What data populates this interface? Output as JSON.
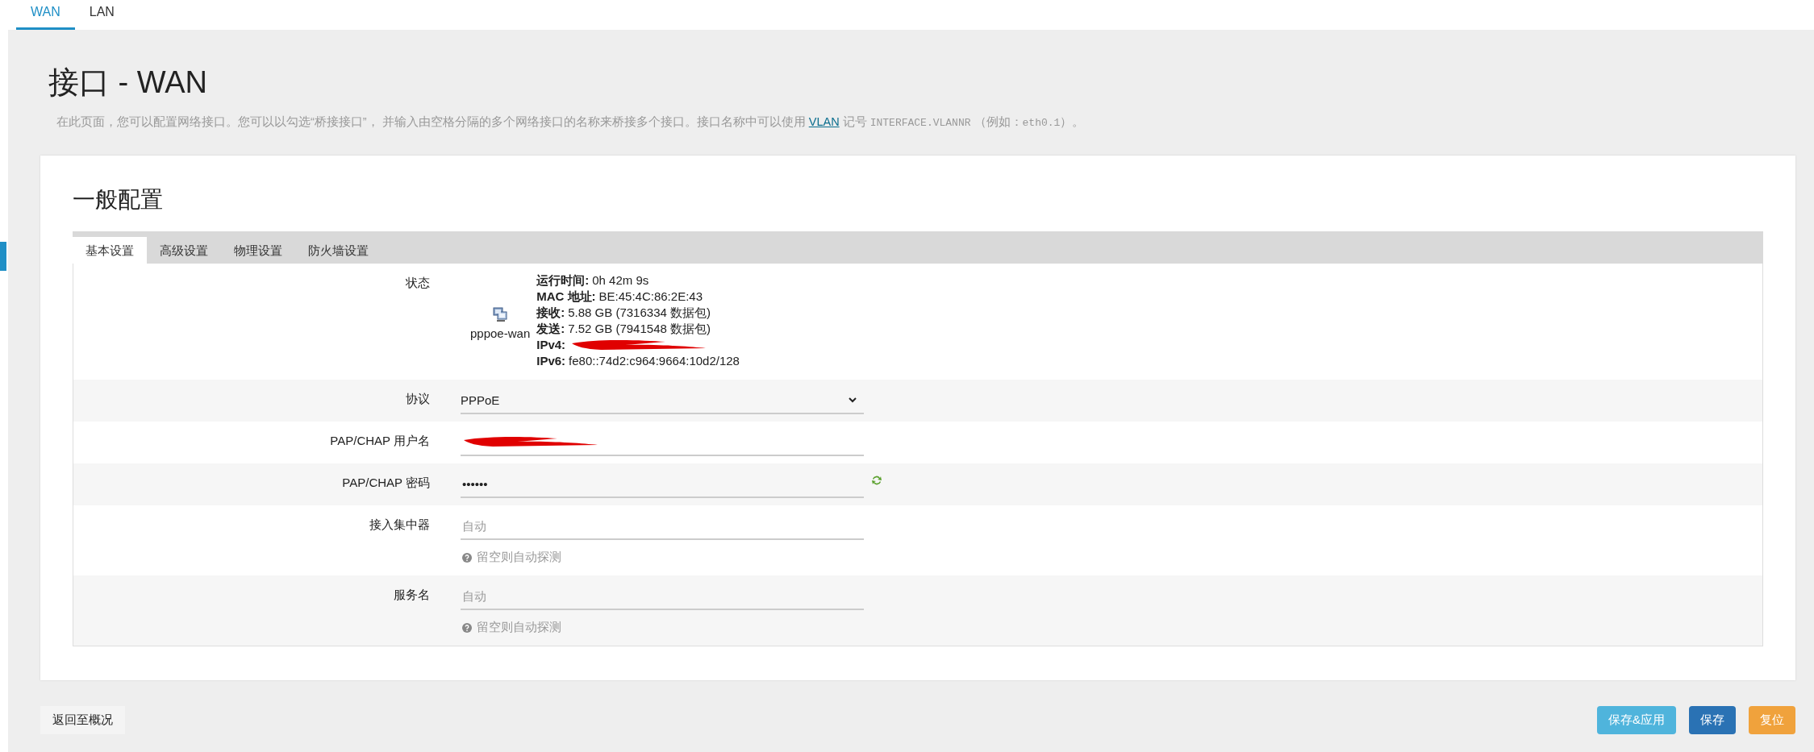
{
  "top_tabs": [
    {
      "label": "WAN",
      "selected": true
    },
    {
      "label": "LAN",
      "selected": false
    }
  ],
  "page": {
    "title": "接口 - WAN",
    "description": "在此页面，您可以配置网络接口。您可以以勾选“桥接接口”， 并输入由空格分隔的多个网络接口的名称来桥接多个接口。接口名称中可以使用 ",
    "description_link": "VLAN",
    "description_tail": " 记号 ",
    "description_code": "INTERFACE.VLANNR",
    "description_end": "（例如：",
    "description_code2": "eth0.1",
    "description_close": "）。"
  },
  "section": {
    "title": "一般配置",
    "tabs": [
      {
        "label": "基本设置",
        "selected": true
      },
      {
        "label": "高级设置",
        "selected": false
      },
      {
        "label": "物理设置",
        "selected": false
      },
      {
        "label": "防火墙设置",
        "selected": false
      }
    ],
    "status": {
      "label": "状态",
      "device": "pppoe-wan",
      "lines": [
        {
          "kind": "text",
          "key": "运行时间:",
          "value": "0h 42m 9s"
        },
        {
          "kind": "text",
          "key": "MAC 地址:",
          "value": "BE:45:4C:86:2E:43"
        },
        {
          "kind": "text",
          "key": "接收:",
          "value": "5.88 GB (7316334 数据包)"
        },
        {
          "kind": "text",
          "key": "发送:",
          "value": "7.52 GB (7941548 数据包)"
        },
        {
          "kind": "redacted",
          "key": "IPv4:"
        },
        {
          "kind": "text",
          "key": "IPv6:",
          "value": "fe80::74d2:c964:9664:10d2/128"
        }
      ]
    },
    "fields": [
      {
        "kind": "select",
        "label": "协议",
        "value": "PPPoE"
      },
      {
        "kind": "redacted",
        "label": "PAP/CHAP 用户名"
      },
      {
        "kind": "password",
        "label": "PAP/CHAP 密码",
        "value": "••••••"
      },
      {
        "kind": "text",
        "label": "接入集中器",
        "placeholder": "自动",
        "hint": "留空则自动探测"
      },
      {
        "kind": "text",
        "label": "服务名",
        "placeholder": "自动",
        "hint": "留空则自动探测"
      }
    ]
  },
  "footer": {
    "back_button": "返回至概况",
    "buttons": [
      {
        "label": "保存&应用",
        "kind": "apply"
      },
      {
        "label": "保存",
        "kind": "save"
      },
      {
        "label": "复位",
        "kind": "reset"
      }
    ]
  }
}
